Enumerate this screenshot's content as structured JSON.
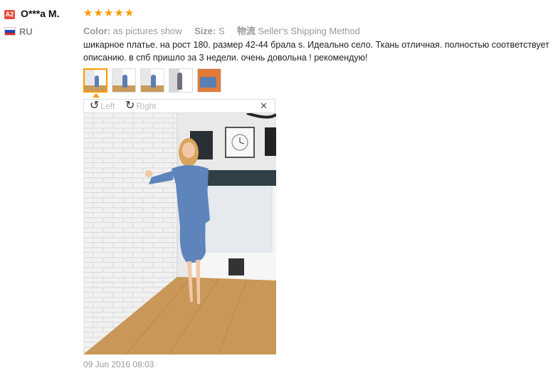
{
  "reviewer": {
    "badge": "A2",
    "name": "O***a M.",
    "country": "RU",
    "flag_colors": [
      "#ffffff",
      "#1c47b8",
      "#d52b1e"
    ]
  },
  "rating": {
    "stars": 5,
    "color": "#ff9900"
  },
  "attributes": {
    "color_label": "Color:",
    "color_value": "as pictures show",
    "size_label": "Size:",
    "size_value": "S",
    "shipping_label": "物流",
    "shipping_value": "Seller's Shipping Method"
  },
  "review_text": "шикарное платье. на рост 180. размер 42-44 брала s. Идеально село. Ткань отличная. полностью соответствует описанию. в спб пришло за 3 недели. очень довольна ! рекомендую!",
  "thumbnails": [
    {
      "name": "thumbnail-1",
      "selected": true
    },
    {
      "name": "thumbnail-2",
      "selected": false
    },
    {
      "name": "thumbnail-3",
      "selected": false
    },
    {
      "name": "thumbnail-4",
      "selected": false
    },
    {
      "name": "thumbnail-5",
      "selected": false
    }
  ],
  "viewer": {
    "rotate_left_label": "Left",
    "rotate_right_label": "Right",
    "rotate_left_icon": "rotate-left-icon",
    "rotate_right_icon": "rotate-right-icon",
    "close_icon": "close-icon",
    "close_glyph": "✕"
  },
  "date": "09 Jun 2016 08:03"
}
